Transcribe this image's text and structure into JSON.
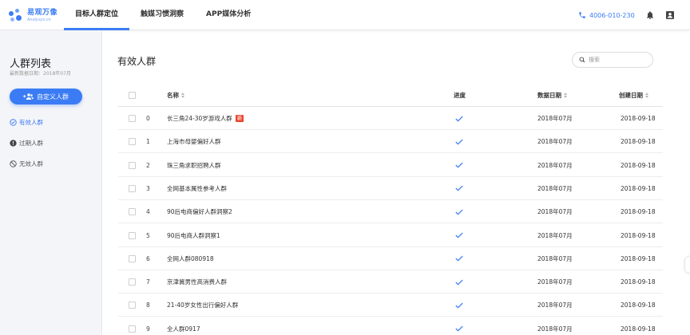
{
  "logo": {
    "cn": "易观万像",
    "en": "Analysys.cn"
  },
  "nav": [
    {
      "label": "目标人群定位",
      "active": true
    },
    {
      "label": "触媒习惯洞察",
      "active": false
    },
    {
      "label": "APP媒体分析",
      "active": false
    }
  ],
  "header": {
    "phone": "4006-010-230",
    "icons": [
      "bell-icon",
      "user-icon"
    ]
  },
  "sidebar": {
    "title": "人群列表",
    "date": "最新数据日期：2018年07月",
    "custom_button": "自定义人群",
    "items": [
      {
        "label": "有效人群",
        "icon": "check-circle-icon",
        "active": true
      },
      {
        "label": "过期人群",
        "icon": "alert-circle-icon",
        "active": false
      },
      {
        "label": "无效人群",
        "icon": "ban-icon",
        "active": false
      }
    ]
  },
  "main": {
    "title": "有效人群",
    "search": {
      "placeholder": "搜索",
      "value": ""
    },
    "columns": {
      "name": "名称",
      "progress": "进度",
      "data_date": "数据日期",
      "created": "创建日期"
    },
    "rows": [
      {
        "idx": "0",
        "name": "长三角24-30岁游戏人群",
        "badge": "新",
        "data_date": "2018年07月",
        "created": "2018-09-18"
      },
      {
        "idx": "1",
        "name": "上海市母婴偏好人群",
        "badge": "",
        "data_date": "2018年07月",
        "created": "2018-09-18"
      },
      {
        "idx": "2",
        "name": "珠三角求职招聘人群",
        "badge": "",
        "data_date": "2018年07月",
        "created": "2018-09-18"
      },
      {
        "idx": "3",
        "name": "全网基本属性参考人群",
        "badge": "",
        "data_date": "2018年07月",
        "created": "2018-09-18"
      },
      {
        "idx": "4",
        "name": "90后电商偏好人群洞察2",
        "badge": "",
        "data_date": "2018年07月",
        "created": "2018-09-18"
      },
      {
        "idx": "5",
        "name": "90后电商人群洞察1",
        "badge": "",
        "data_date": "2018年07月",
        "created": "2018-09-18"
      },
      {
        "idx": "6",
        "name": "全网人群080918",
        "badge": "",
        "data_date": "2018年07月",
        "created": "2018-09-18"
      },
      {
        "idx": "7",
        "name": "京津冀男性高消费人群",
        "badge": "",
        "data_date": "2018年07月",
        "created": "2018-09-18"
      },
      {
        "idx": "8",
        "name": "21-40岁女性出行偏好人群",
        "badge": "",
        "data_date": "2018年07月",
        "created": "2018-09-18"
      },
      {
        "idx": "9",
        "name": "全人群0917",
        "badge": "",
        "data_date": "2018年07月",
        "created": "2018-09-18"
      }
    ]
  },
  "colors": {
    "accent": "#3b7cf4",
    "badge": "#e8452c",
    "sidebar_bg": "#f4f5f8"
  }
}
